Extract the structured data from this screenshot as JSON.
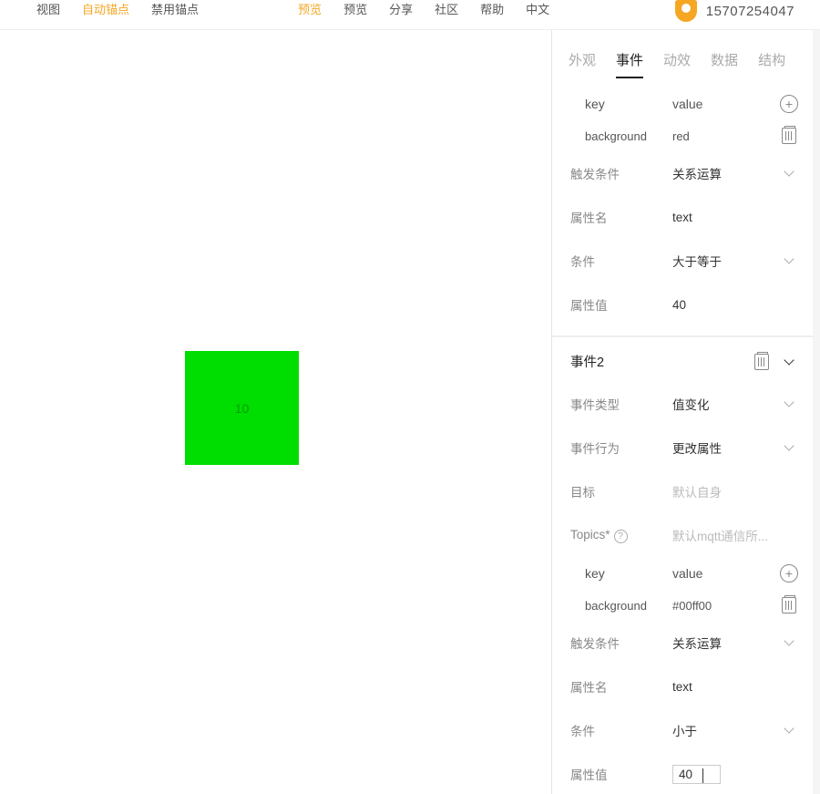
{
  "topbar": {
    "g1": [
      "视图",
      "自动锚点",
      "禁用锚点"
    ],
    "g1_active": 1,
    "g2": [
      "预览",
      "预览",
      "分享",
      "社区",
      "帮助",
      "中文"
    ],
    "g2_active": 0,
    "username": "15707254047"
  },
  "canvas": {
    "shape_text": "10"
  },
  "tabs": {
    "items": [
      "外观",
      "事件",
      "动效",
      "数据",
      "结构"
    ],
    "active": 1
  },
  "section1": {
    "kv_head_k": "key",
    "kv_head_v": "value",
    "kv_rows": [
      {
        "k": "background",
        "v": "red"
      }
    ],
    "rows": [
      {
        "label": "触发条件",
        "value": "关系运算",
        "chev": true
      },
      {
        "label": "属性名",
        "value": "text"
      },
      {
        "label": "条件",
        "value": "大于等于",
        "chev": true
      },
      {
        "label": "属性值",
        "value": "40"
      }
    ]
  },
  "event2": {
    "title": "事件2",
    "rows": [
      {
        "label": "事件类型",
        "value": "值变化",
        "chev": true
      },
      {
        "label": "事件行为",
        "value": "更改属性",
        "chev": true
      },
      {
        "label": "目标",
        "value": "默认自身",
        "ph": true
      },
      {
        "label": "Topics*",
        "value": "默认mqtt通信所...",
        "ph": true,
        "help": true
      }
    ],
    "kv_head_k": "key",
    "kv_head_v": "value",
    "kv_rows": [
      {
        "k": "background",
        "v": "#00ff00"
      }
    ],
    "rows2": [
      {
        "label": "触发条件",
        "value": "关系运算",
        "chev": true
      },
      {
        "label": "属性名",
        "value": "text"
      },
      {
        "label": "条件",
        "value": "小于",
        "chev": true
      },
      {
        "label": "属性值",
        "value": "40",
        "input": true
      }
    ]
  }
}
